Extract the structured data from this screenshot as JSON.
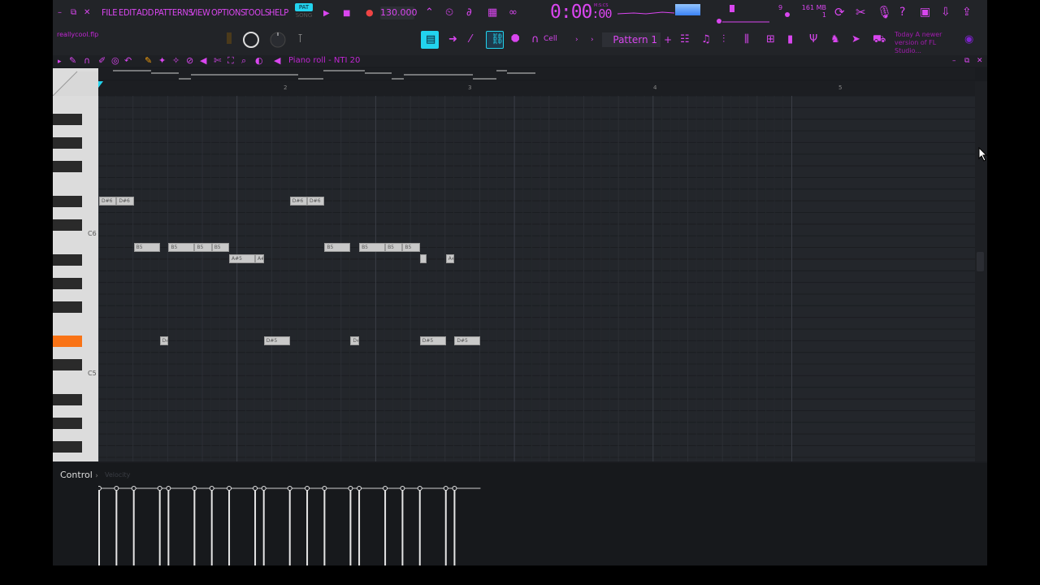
{
  "window": {
    "menu": [
      "FILE",
      "EDIT",
      "ADD",
      "PATTERNS",
      "VIEW",
      "OPTIONS",
      "TOOLS",
      "HELP"
    ],
    "project_name": "reallycool.flp",
    "mode_pat": "PAT",
    "mode_song": "SONG",
    "tempo": "130.000",
    "time_main": "0:00",
    "time_sub": ":00",
    "time_unit": "M:S:CS",
    "cpu_top": "161 MB",
    "cpu_bottom": "1",
    "cpu_voices": "9",
    "pattern_name": "Pattern 1",
    "snap_label": "Cell",
    "news_line1": "Today  A newer",
    "news_line2": "version of FL Studio..."
  },
  "piano_roll": {
    "title": "Piano roll - NTI 20",
    "bar_numbers": [
      "2",
      "3",
      "4",
      "5"
    ],
    "key_labels": [
      "C6",
      "C5"
    ],
    "notes": [
      {
        "label": "D#6",
        "start": 1.0,
        "len": 0.5,
        "row": "D#6"
      },
      {
        "label": "D#6",
        "start": 1.5,
        "len": 0.5,
        "row": "D#6"
      },
      {
        "label": "B5",
        "start": 2.0,
        "len": 0.75,
        "row": "B5"
      },
      {
        "label": "D#5",
        "start": 2.75,
        "len": 0.25,
        "row": "D#5"
      },
      {
        "label": "B5",
        "start": 3.0,
        "len": 0.75,
        "row": "B5"
      },
      {
        "label": "B5",
        "start": 3.75,
        "len": 0.5,
        "row": "B5"
      },
      {
        "label": "B5",
        "start": 4.25,
        "len": 0.5,
        "row": "B5"
      },
      {
        "label": "A#5",
        "start": 4.75,
        "len": 0.75,
        "row": "A#5"
      },
      {
        "label": "A#5",
        "start": 5.5,
        "len": 0.25,
        "row": "A#5"
      },
      {
        "label": "D#5",
        "start": 5.75,
        "len": 0.75,
        "row": "D#5"
      },
      {
        "label": "D#6",
        "start": 6.5,
        "len": 0.5,
        "row": "D#6"
      },
      {
        "label": "D#6",
        "start": 7.0,
        "len": 0.5,
        "row": "D#6"
      },
      {
        "label": "B5",
        "start": 7.5,
        "len": 0.75,
        "row": "B5"
      },
      {
        "label": "D#5",
        "start": 8.25,
        "len": 0.25,
        "row": "D#5"
      },
      {
        "label": "B5",
        "start": 8.5,
        "len": 0.75,
        "row": "B5"
      },
      {
        "label": "B5",
        "start": 9.25,
        "len": 0.5,
        "row": "B5"
      },
      {
        "label": "B5",
        "start": 9.75,
        "len": 0.5,
        "row": "B5"
      },
      {
        "label": "",
        "start": 10.25,
        "len": 0.125,
        "row": "A#5"
      },
      {
        "label": "D#5",
        "start": 10.25,
        "len": 0.75,
        "row": "D#5"
      },
      {
        "label": "A#5",
        "start": 11.0,
        "len": 0.25,
        "row": "A#5"
      },
      {
        "label": "D#5",
        "start": 11.25,
        "len": 0.75,
        "row": "D#5"
      }
    ]
  },
  "control": {
    "label": "Control",
    "arrow": "›",
    "target": "Velocity",
    "velocity_steps": [
      1.0,
      1.5,
      2.0,
      2.75,
      3.0,
      3.75,
      4.25,
      4.75,
      5.5,
      5.75,
      6.5,
      7.0,
      7.5,
      8.25,
      8.5,
      9.25,
      9.75,
      10.25,
      11.0,
      11.25
    ]
  },
  "colors": {
    "accent": "#d946ef",
    "active": "#22d3ee",
    "note": "#c9c9c9",
    "highlight_key": "#f97316"
  }
}
